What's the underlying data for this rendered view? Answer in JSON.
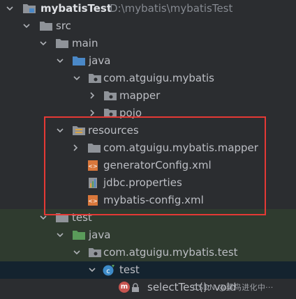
{
  "tree": {
    "root": {
      "label": "mybatisTest",
      "path": "D:\\mybatis\\mybatisTest"
    },
    "src": "src",
    "main": "main",
    "java_main": "java",
    "pkg_main": "com.atguigu.mybatis",
    "mapper": "mapper",
    "pojo": "pojo",
    "resources": "resources",
    "pkg_mapper": "com.atguigu.mybatis.mapper",
    "generator_config": "generatorConfig.xml",
    "jdbc_properties": "jdbc.properties",
    "mybatis_config": "mybatis-config.xml",
    "test": "test",
    "java_test": "java",
    "pkg_test": "com.atguigu.mybatis.test",
    "test_class": "test",
    "method": "selectTest(): void",
    "method_badge": "m"
  },
  "watermark": "CSDN @菜鸟进化中···",
  "colors": {
    "highlight_box": "#e53935",
    "folder_gray": "#8f9399",
    "folder_blue": "#4a88c7",
    "folder_green": "#5a9b5a",
    "xml_orange": "#d9773b"
  }
}
